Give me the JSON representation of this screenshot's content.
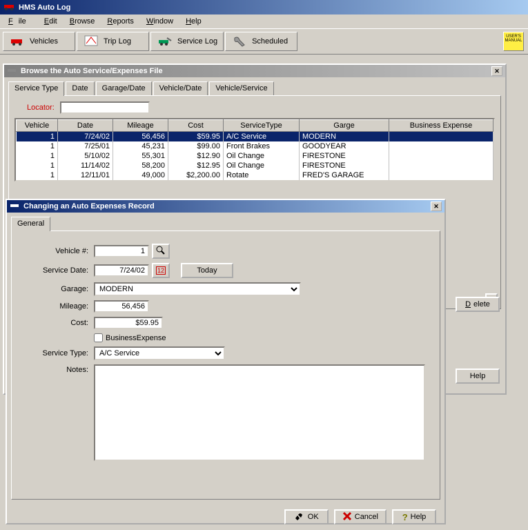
{
  "app": {
    "title": "HMS Auto Log"
  },
  "menu": {
    "file": "File",
    "edit": "Edit",
    "browse": "Browse",
    "reports": "Reports",
    "window": "Window",
    "help": "Help"
  },
  "toolbar": {
    "vehicles": "Vehicles",
    "triplog": "Trip Log",
    "servicelog": "Service Log",
    "scheduled": "Scheduled",
    "manual": "USER'S MANUAL"
  },
  "browseWin": {
    "title": "Browse the Auto Service/Expenses File",
    "tabs": {
      "servicetype": "Service Type",
      "date": "Date",
      "garagedate": "Garage/Date",
      "vehicledate": "Vehicle/Date",
      "vehicleservice": "Vehicle/Service"
    },
    "locator": "Locator:",
    "cols": {
      "vehicle": "Vehicle",
      "date": "Date",
      "mileage": "Mileage",
      "cost": "Cost",
      "servicetype": "ServiceType",
      "garage": "Garge",
      "bexp": "Business Expense"
    },
    "rows": [
      {
        "v": "1",
        "d": "7/24/02",
        "m": "56,456",
        "c": "$59.95",
        "s": "A/C Service",
        "g": "MODERN"
      },
      {
        "v": "1",
        "d": "7/25/01",
        "m": "45,231",
        "c": "$99.00",
        "s": "Front Brakes",
        "g": "GOODYEAR"
      },
      {
        "v": "1",
        "d": "5/10/02",
        "m": "55,301",
        "c": "$12.90",
        "s": "Oil Change",
        "g": "FIRESTONE"
      },
      {
        "v": "1",
        "d": "11/14/02",
        "m": "58,200",
        "c": "$12.95",
        "s": "Oil Change",
        "g": "FIRESTONE"
      },
      {
        "v": "1",
        "d": "12/11/01",
        "m": "49,000",
        "c": "$2,200.00",
        "s": "Rotate",
        "g": "FRED'S GARAGE"
      }
    ],
    "delete": "Delete",
    "help": "Help"
  },
  "editWin": {
    "title": "Changing an Auto Expenses Record",
    "tab": "General",
    "labels": {
      "vehicle": "Vehicle #:",
      "servicedate": "Service Date:",
      "garage": "Garage:",
      "mileage": "Mileage:",
      "cost": "Cost:",
      "bexp": "BusinessExpense",
      "servicetype": "Service Type:",
      "notes": "Notes:"
    },
    "values": {
      "vehicle": "1",
      "servicedate": "7/24/02",
      "garage": "MODERN",
      "mileage": "56,456",
      "cost": "$59.95",
      "servicetype": "A/C Service"
    },
    "today": "Today",
    "ok": "OK",
    "cancel": "Cancel",
    "help": "Help"
  }
}
